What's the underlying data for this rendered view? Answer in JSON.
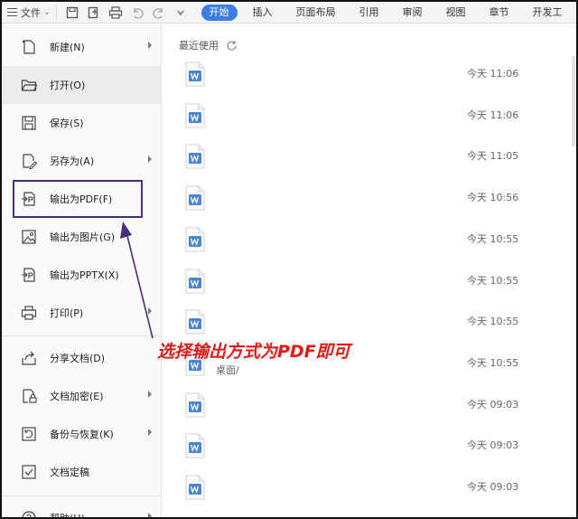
{
  "toolbar": {
    "file_label": "文件",
    "tabs": [
      {
        "label": "开始",
        "active": true
      },
      {
        "label": "插入",
        "active": false
      },
      {
        "label": "页面布局",
        "active": false
      },
      {
        "label": "引用",
        "active": false
      },
      {
        "label": "审阅",
        "active": false
      },
      {
        "label": "视图",
        "active": false
      },
      {
        "label": "章节",
        "active": false
      },
      {
        "label": "开发工",
        "active": false
      }
    ],
    "icons": [
      "save-icon",
      "template-icon",
      "print-icon",
      "undo-icon",
      "redo-icon",
      "more-dropdown-icon"
    ]
  },
  "menu": {
    "new": "新建(N)",
    "open": "打开(O)",
    "save": "保存(S)",
    "save_as": "另存为(A)",
    "export_pdf": "输出为PDF(F)",
    "export_image": "输出为图片(G)",
    "export_pptx": "输出为PPTX(X)",
    "print": "打印(P)",
    "share": "分享文档(D)",
    "encrypt": "文档加密(E)",
    "backup": "备份与恢复(K)",
    "finalize": "文档定稿",
    "help": "帮助(H)"
  },
  "recent": {
    "title": "最近使用",
    "files": [
      {
        "time": "今天  11:06"
      },
      {
        "time": "今天  11:06"
      },
      {
        "time": "今天  11:05"
      },
      {
        "time": "今天  10:56"
      },
      {
        "time": "今天  10:55"
      },
      {
        "time": "今天  10:55"
      },
      {
        "time": "今天  10:55"
      },
      {
        "time": "今天  10:55",
        "path": "桌面/"
      },
      {
        "time": "今天  09:03"
      },
      {
        "time": "今天  09:03"
      },
      {
        "time": "今天  09:03"
      }
    ]
  },
  "annotation": {
    "text": "选择输出方式为PDF即可",
    "color": "#e01919",
    "box_color": "#4b2e7f"
  },
  "colors": {
    "accent": "#3d7de8",
    "doc_icon": "#4a86d8"
  }
}
